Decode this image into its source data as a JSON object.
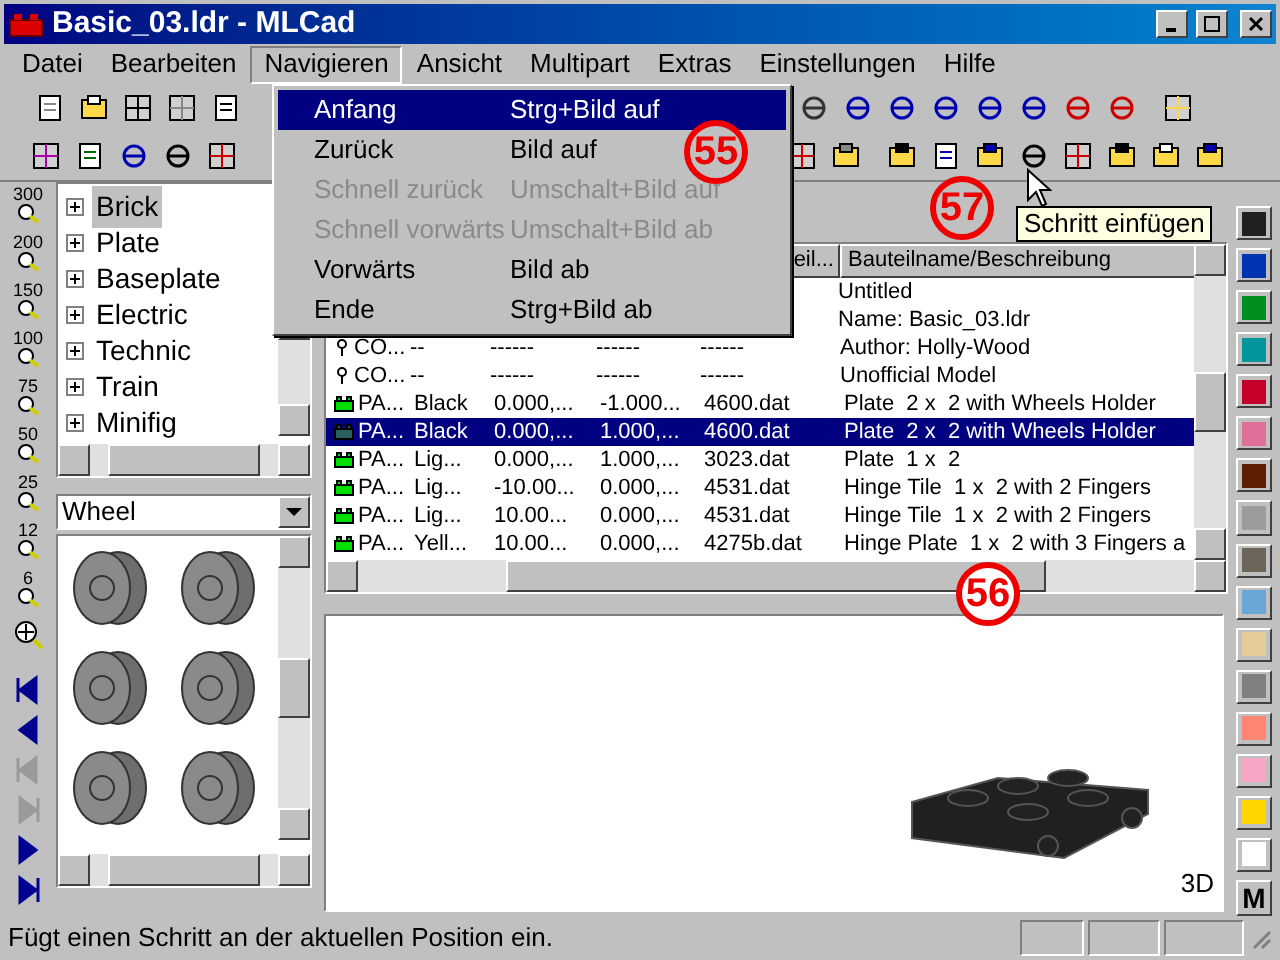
{
  "window": {
    "title": "Basic_03.ldr - MLCad"
  },
  "menu_bar": [
    {
      "label": "Datei",
      "selected": false
    },
    {
      "label": "Bearbeiten",
      "selected": false
    },
    {
      "label": "Navigieren",
      "selected": true
    },
    {
      "label": "Ansicht",
      "selected": false
    },
    {
      "label": "Multipart",
      "selected": false
    },
    {
      "label": "Extras",
      "selected": false
    },
    {
      "label": "Einstellungen",
      "selected": false
    },
    {
      "label": "Hilfe",
      "selected": false
    }
  ],
  "open_menu": [
    {
      "label": "Anfang",
      "shortcut": "Strg+Bild auf",
      "selected": true,
      "disabled": false
    },
    {
      "label": "Zurück",
      "shortcut": "Bild auf",
      "selected": false,
      "disabled": false
    },
    {
      "label": "Schnell zurück",
      "shortcut": "Umschalt+Bild auf",
      "selected": false,
      "disabled": true
    },
    {
      "label": "Schnell vorwärts",
      "shortcut": "Umschalt+Bild ab",
      "selected": false,
      "disabled": true
    },
    {
      "label": "Vorwärts",
      "shortcut": "Bild ab",
      "selected": false,
      "disabled": false
    },
    {
      "label": "Ende",
      "shortcut": "Strg+Bild ab",
      "selected": false,
      "disabled": false
    }
  ],
  "zoom_levels": [
    "300",
    "200",
    "150",
    "100",
    "75",
    "50",
    "25",
    "12",
    "6"
  ],
  "nav_buttons": [
    {
      "disabled": false
    },
    {
      "disabled": false
    },
    {
      "disabled": true
    },
    {
      "disabled": true
    },
    {
      "disabled": false
    },
    {
      "disabled": false
    }
  ],
  "tree": [
    {
      "label": "Brick",
      "selected": true,
      "expanded": false
    },
    {
      "label": "Plate",
      "selected": false,
      "expanded": false
    },
    {
      "label": "Baseplate",
      "selected": false,
      "expanded": false
    },
    {
      "label": "Electric",
      "selected": false,
      "expanded": false
    },
    {
      "label": "Technic",
      "selected": false,
      "expanded": false
    },
    {
      "label": "Train",
      "selected": false,
      "expanded": false
    },
    {
      "label": "Minifig",
      "selected": false,
      "expanded": false
    }
  ],
  "part_category": "Wheel",
  "table": {
    "columns": [
      "",
      "",
      "",
      "",
      "eil...",
      "Bauteilname/Beschreibung"
    ],
    "rows": [
      {
        "kind": "hidden",
        "cells": [
          "",
          "",
          "",
          "",
          "",
          "Untitled"
        ],
        "selected": false
      },
      {
        "kind": "hidden",
        "cells": [
          "",
          "",
          "",
          "",
          "",
          "Name: Basic_03.ldr"
        ],
        "selected": false
      },
      {
        "kind": "comment",
        "cells": [
          "CO...",
          "--",
          "------",
          "------",
          "------",
          "Author: Holly-Wood"
        ],
        "selected": false
      },
      {
        "kind": "comment",
        "cells": [
          "CO...",
          "--",
          "------",
          "------",
          "------",
          "Unofficial Model"
        ],
        "selected": false
      },
      {
        "kind": "part",
        "cells": [
          "PA...",
          "Black",
          "0.000,...",
          "-1.000...",
          "4600.dat",
          "Plate  2 x  2 with Wheels Holder"
        ],
        "selected": false
      },
      {
        "kind": "part",
        "cells": [
          "PA...",
          "Black",
          "0.000,...",
          "1.000,...",
          "4600.dat",
          "Plate  2 x  2 with Wheels Holder"
        ],
        "selected": true
      },
      {
        "kind": "part",
        "cells": [
          "PA...",
          "Lig...",
          "0.000,...",
          "1.000,...",
          "3023.dat",
          "Plate  1 x  2"
        ],
        "selected": false
      },
      {
        "kind": "part",
        "cells": [
          "PA...",
          "Lig...",
          "-10.00...",
          "0.000,...",
          "4531.dat",
          "Hinge Tile  1 x  2 with 2 Fingers"
        ],
        "selected": false
      },
      {
        "kind": "part",
        "cells": [
          "PA...",
          "Lig...",
          "10.00...",
          "0.000,...",
          "4531.dat",
          "Hinge Tile  1 x  2 with 2 Fingers"
        ],
        "selected": false
      },
      {
        "kind": "part",
        "cells": [
          "PA...",
          "Yell...",
          "10.00...",
          "0.000,...",
          "4275b.dat",
          "Hinge Plate  1 x  2 with 3 Fingers a"
        ],
        "selected": false
      }
    ]
  },
  "tooltip": "Schritt einfügen",
  "callouts": [
    "55",
    "56",
    "57"
  ],
  "palette": [
    {
      "color": "#202020"
    },
    {
      "color": "#0033b2"
    },
    {
      "color": "#008f1f"
    },
    {
      "color": "#00969c"
    },
    {
      "color": "#c4002b"
    },
    {
      "color": "#e06f9c"
    },
    {
      "color": "#5c2000"
    },
    {
      "color": "#9c9c9c"
    },
    {
      "color": "#6b6659"
    },
    {
      "color": "#6ba6d9"
    },
    {
      "color": "#e6cc99"
    },
    {
      "color": "#808080"
    },
    {
      "color": "#ff8575"
    },
    {
      "color": "#f7a6c7"
    },
    {
      "color": "#ffd600"
    },
    {
      "color": "#ffffff"
    }
  ],
  "palette_button": "M",
  "view_label": "3D",
  "status_bar": "Fügt einen Schritt an der aktuellen Position ein."
}
